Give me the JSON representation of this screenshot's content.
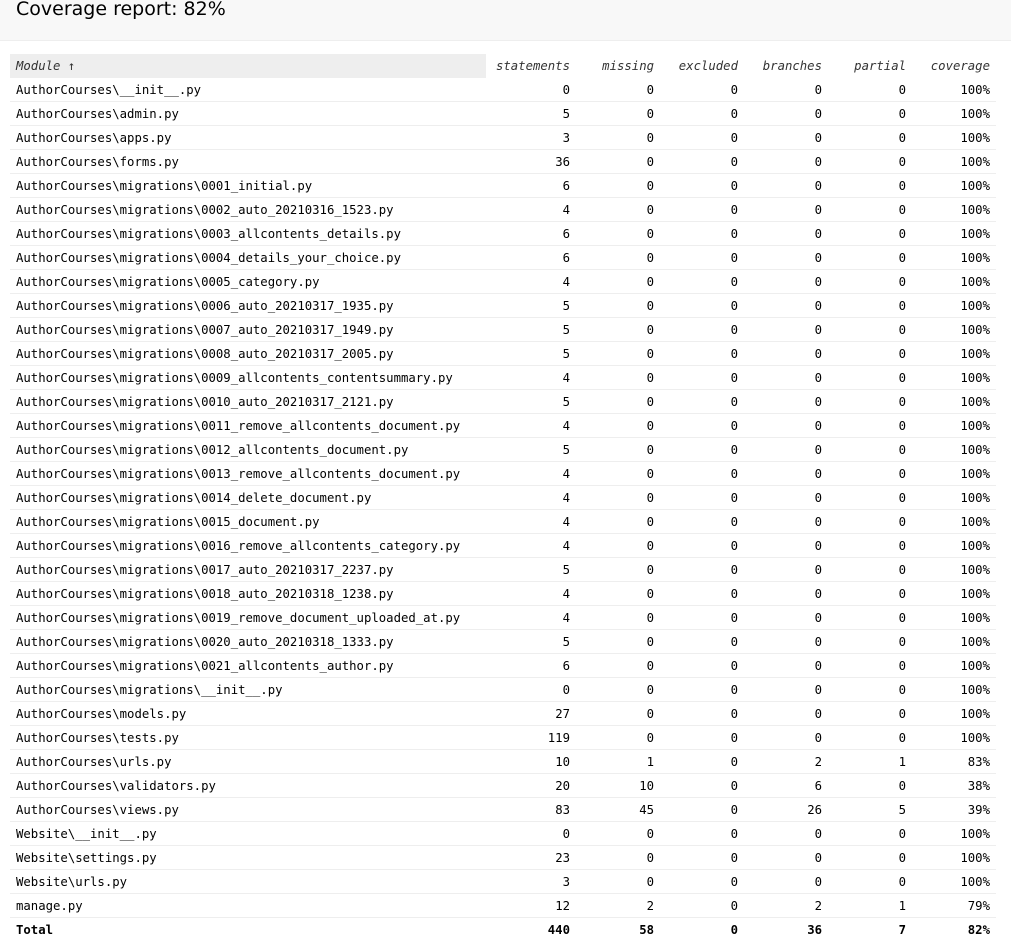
{
  "page": {
    "title": "Coverage report: 82%"
  },
  "table": {
    "columns": [
      "Module ↑",
      "statements",
      "missing",
      "excluded",
      "branches",
      "partial",
      "coverage"
    ],
    "rows": [
      [
        "AuthorCourses\\__init__.py",
        "0",
        "0",
        "0",
        "0",
        "0",
        "100%"
      ],
      [
        "AuthorCourses\\admin.py",
        "5",
        "0",
        "0",
        "0",
        "0",
        "100%"
      ],
      [
        "AuthorCourses\\apps.py",
        "3",
        "0",
        "0",
        "0",
        "0",
        "100%"
      ],
      [
        "AuthorCourses\\forms.py",
        "36",
        "0",
        "0",
        "0",
        "0",
        "100%"
      ],
      [
        "AuthorCourses\\migrations\\0001_initial.py",
        "6",
        "0",
        "0",
        "0",
        "0",
        "100%"
      ],
      [
        "AuthorCourses\\migrations\\0002_auto_20210316_1523.py",
        "4",
        "0",
        "0",
        "0",
        "0",
        "100%"
      ],
      [
        "AuthorCourses\\migrations\\0003_allcontents_details.py",
        "6",
        "0",
        "0",
        "0",
        "0",
        "100%"
      ],
      [
        "AuthorCourses\\migrations\\0004_details_your_choice.py",
        "6",
        "0",
        "0",
        "0",
        "0",
        "100%"
      ],
      [
        "AuthorCourses\\migrations\\0005_category.py",
        "4",
        "0",
        "0",
        "0",
        "0",
        "100%"
      ],
      [
        "AuthorCourses\\migrations\\0006_auto_20210317_1935.py",
        "5",
        "0",
        "0",
        "0",
        "0",
        "100%"
      ],
      [
        "AuthorCourses\\migrations\\0007_auto_20210317_1949.py",
        "5",
        "0",
        "0",
        "0",
        "0",
        "100%"
      ],
      [
        "AuthorCourses\\migrations\\0008_auto_20210317_2005.py",
        "5",
        "0",
        "0",
        "0",
        "0",
        "100%"
      ],
      [
        "AuthorCourses\\migrations\\0009_allcontents_contentsummary.py",
        "4",
        "0",
        "0",
        "0",
        "0",
        "100%"
      ],
      [
        "AuthorCourses\\migrations\\0010_auto_20210317_2121.py",
        "5",
        "0",
        "0",
        "0",
        "0",
        "100%"
      ],
      [
        "AuthorCourses\\migrations\\0011_remove_allcontents_document.py",
        "4",
        "0",
        "0",
        "0",
        "0",
        "100%"
      ],
      [
        "AuthorCourses\\migrations\\0012_allcontents_document.py",
        "5",
        "0",
        "0",
        "0",
        "0",
        "100%"
      ],
      [
        "AuthorCourses\\migrations\\0013_remove_allcontents_document.py",
        "4",
        "0",
        "0",
        "0",
        "0",
        "100%"
      ],
      [
        "AuthorCourses\\migrations\\0014_delete_document.py",
        "4",
        "0",
        "0",
        "0",
        "0",
        "100%"
      ],
      [
        "AuthorCourses\\migrations\\0015_document.py",
        "4",
        "0",
        "0",
        "0",
        "0",
        "100%"
      ],
      [
        "AuthorCourses\\migrations\\0016_remove_allcontents_category.py",
        "4",
        "0",
        "0",
        "0",
        "0",
        "100%"
      ],
      [
        "AuthorCourses\\migrations\\0017_auto_20210317_2237.py",
        "5",
        "0",
        "0",
        "0",
        "0",
        "100%"
      ],
      [
        "AuthorCourses\\migrations\\0018_auto_20210318_1238.py",
        "4",
        "0",
        "0",
        "0",
        "0",
        "100%"
      ],
      [
        "AuthorCourses\\migrations\\0019_remove_document_uploaded_at.py",
        "4",
        "0",
        "0",
        "0",
        "0",
        "100%"
      ],
      [
        "AuthorCourses\\migrations\\0020_auto_20210318_1333.py",
        "5",
        "0",
        "0",
        "0",
        "0",
        "100%"
      ],
      [
        "AuthorCourses\\migrations\\0021_allcontents_author.py",
        "6",
        "0",
        "0",
        "0",
        "0",
        "100%"
      ],
      [
        "AuthorCourses\\migrations\\__init__.py",
        "0",
        "0",
        "0",
        "0",
        "0",
        "100%"
      ],
      [
        "AuthorCourses\\models.py",
        "27",
        "0",
        "0",
        "0",
        "0",
        "100%"
      ],
      [
        "AuthorCourses\\tests.py",
        "119",
        "0",
        "0",
        "0",
        "0",
        "100%"
      ],
      [
        "AuthorCourses\\urls.py",
        "10",
        "1",
        "0",
        "2",
        "1",
        "83%"
      ],
      [
        "AuthorCourses\\validators.py",
        "20",
        "10",
        "0",
        "6",
        "0",
        "38%"
      ],
      [
        "AuthorCourses\\views.py",
        "83",
        "45",
        "0",
        "26",
        "5",
        "39%"
      ],
      [
        "Website\\__init__.py",
        "0",
        "0",
        "0",
        "0",
        "0",
        "100%"
      ],
      [
        "Website\\settings.py",
        "23",
        "0",
        "0",
        "0",
        "0",
        "100%"
      ],
      [
        "Website\\urls.py",
        "3",
        "0",
        "0",
        "0",
        "0",
        "100%"
      ],
      [
        "manage.py",
        "12",
        "2",
        "0",
        "2",
        "1",
        "79%"
      ]
    ],
    "total": [
      "Total",
      "440",
      "58",
      "0",
      "36",
      "7",
      "82%"
    ]
  }
}
